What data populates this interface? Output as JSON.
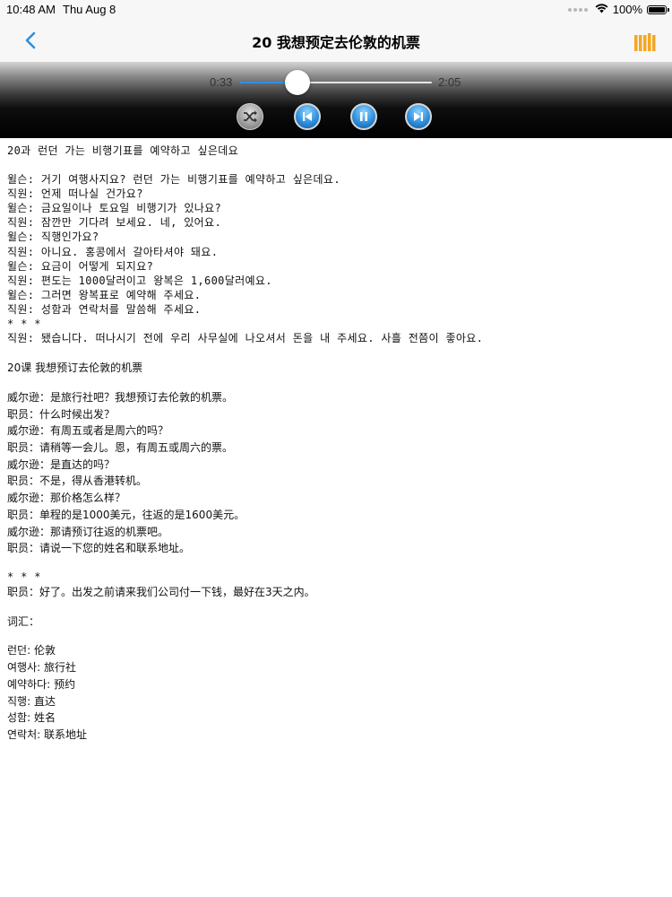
{
  "status_bar": {
    "time": "10:48 AM",
    "date": "Thu Aug 8",
    "battery_text": "100%",
    "battery_level": 1.0
  },
  "nav": {
    "title": "20 我想预定去伦敦的机票",
    "back_icon": "chevron-left-icon",
    "library_icon": "library-icon",
    "accent_color": "#2f8fdc",
    "library_color": "#f5a623"
  },
  "player": {
    "elapsed": "0:33",
    "total": "2:05",
    "progress": 0.3,
    "controls": [
      "shuffle-icon",
      "previous-icon",
      "pause-icon",
      "next-icon"
    ]
  },
  "content": {
    "korean_title": "20과 런던 가는 비행기표를 예약하고 싶은데요",
    "korean_dialog": [
      "윌슨: 거기 여행사지요? 런던 가는 비행기표를 예약하고 싶은데요.",
      "직원: 언제 떠나실 건가요?",
      "윌슨: 금요일이나 토요일 비행기가 있나요?",
      "직원: 잠깐만 기다려 보세요. 네, 있어요.",
      "윌슨: 직행인가요?",
      "직원: 아니요. 홍콩에서 갈아타셔야 돼요.",
      "윌슨: 요금이 어떻게 되지요?",
      "직원: 편도는 1000달러이고 왕복은 1,600달러예요.",
      "윌슨: 그러면 왕복표로 예약해 주세요.",
      "직원: 성함과 연락처를 말씀해 주세요.",
      "* * *",
      "직원: 됐습니다. 떠나시기 전에 우리 사무실에 나오셔서 돈을 내 주세요. 사흘 전쯤이 좋아요."
    ],
    "chinese_title": "20课 我想预订去伦敦的机票",
    "chinese_dialog": [
      "威尔逊：是旅行社吧？我想预订去伦敦的机票。",
      "职员：什么时候出发？",
      "威尔逊：有周五或者是周六的吗？",
      "职员：请稍等一会儿。恩，有周五或周六的票。",
      "威尔逊：是直达的吗？",
      "职员：不是，得从香港转机。",
      "威尔逊：那价格怎么样？",
      "职员：单程的是1000美元，往返的是1600美元。",
      "威尔逊：那请预订往返的机票吧。",
      "职员：请说一下您的姓名和联系地址。"
    ],
    "chinese_stars": "* * *",
    "chinese_closing": "职员：好了。出发之前请来我们公司付一下钱，最好在3天之内。",
    "vocab_title": "词汇：",
    "vocab": [
      "런던: 伦敦",
      "여행사: 旅行社",
      "예약하다: 预约",
      "직행: 直达",
      "성함: 姓名",
      "연락처: 联系地址"
    ]
  }
}
